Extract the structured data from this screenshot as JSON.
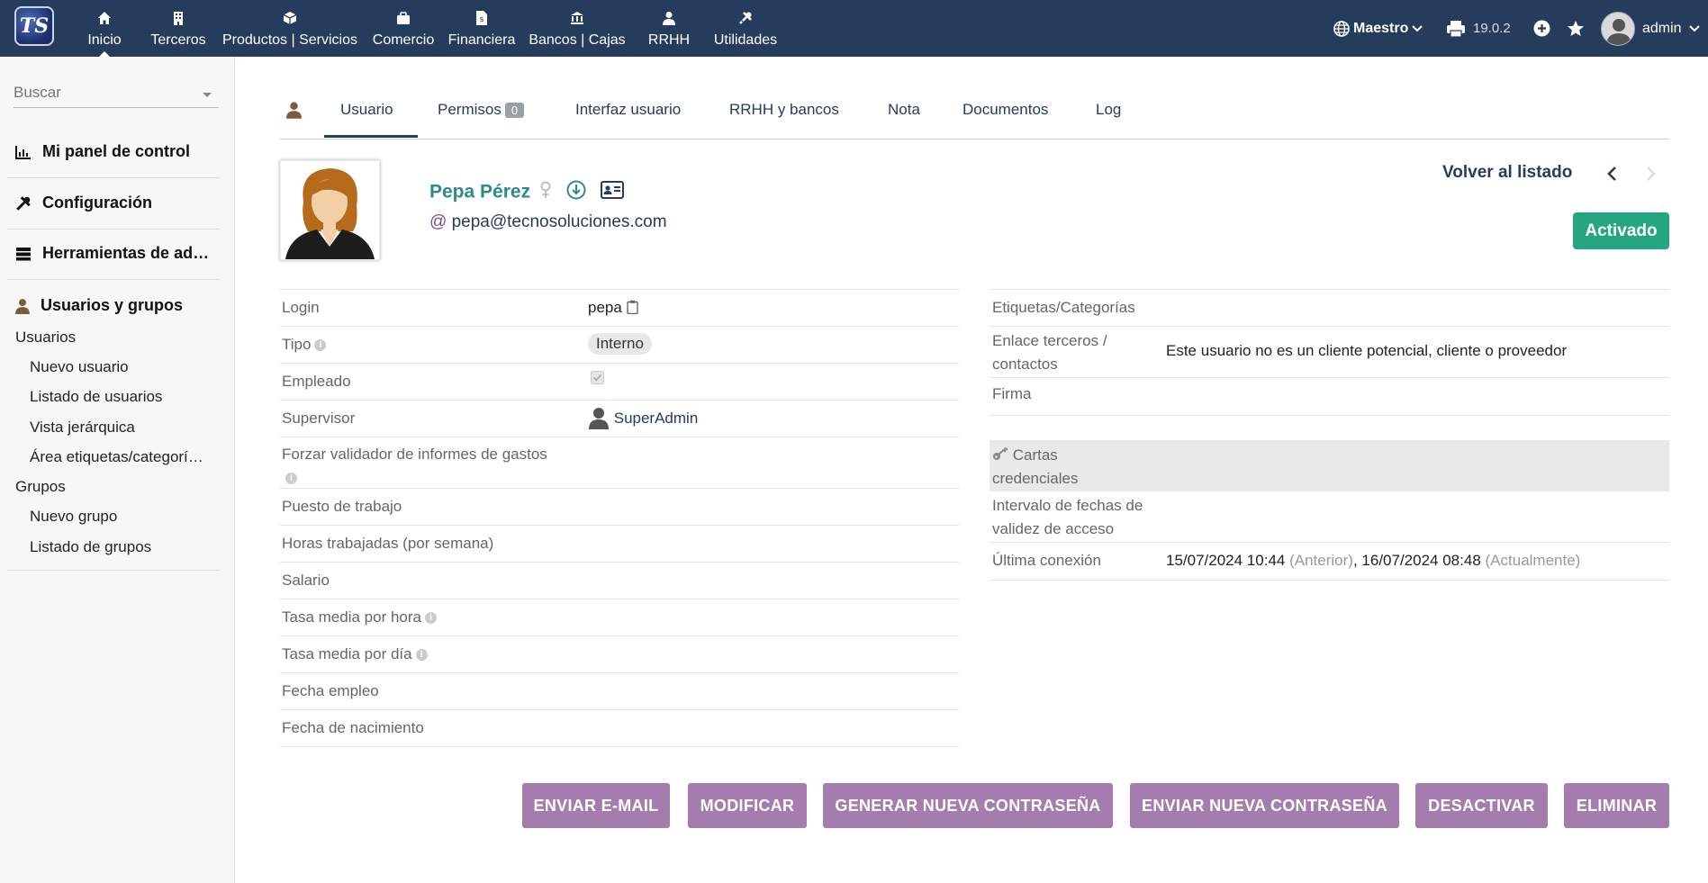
{
  "topbar": {
    "logo_text": "TS",
    "menu": [
      {
        "label": "Inicio",
        "icon": "home-icon"
      },
      {
        "label": "Terceros",
        "icon": "building-icon"
      },
      {
        "label": "Productos | Servicios",
        "icon": "cube-icon"
      },
      {
        "label": "Comercio",
        "icon": "briefcase-icon"
      },
      {
        "label": "Financiera",
        "icon": "invoice-icon"
      },
      {
        "label": "Bancos | Cajas",
        "icon": "bank-icon"
      },
      {
        "label": "RRHH",
        "icon": "user-icon"
      },
      {
        "label": "Utilidades",
        "icon": "tools-icon"
      }
    ],
    "entity": "Maestro",
    "version": "19.0.2",
    "user": "admin"
  },
  "sidebar": {
    "search_placeholder": "Buscar",
    "sections": [
      {
        "label": "Mi panel de control",
        "icon": "chart-icon"
      },
      {
        "label": "Configuración",
        "icon": "tools-icon"
      },
      {
        "label": "Herramientas de ad…",
        "icon": "server-icon"
      },
      {
        "label": "Usuarios y grupos",
        "icon": "user-icon"
      }
    ],
    "users_heading": "Usuarios",
    "users_links": [
      "Nuevo usuario",
      "Listado de usuarios",
      "Vista jerárquica",
      "Área etiquetas/categorí…"
    ],
    "groups_heading": "Grupos",
    "groups_links": [
      "Nuevo grupo",
      "Listado de grupos"
    ]
  },
  "tabs": {
    "items": [
      "Usuario",
      "Permisos",
      "Interfaz usuario",
      "RRHH y bancos",
      "Nota",
      "Documentos",
      "Log"
    ],
    "permisos_count": "0"
  },
  "header": {
    "name": "Pepa Pérez",
    "email_prefix": "@",
    "email": "pepa@tecnosoluciones.com",
    "back_label": "Volver al listado",
    "status": "Activado"
  },
  "left_fields": [
    {
      "label": "Login",
      "value": "pepa"
    },
    {
      "label": "Tipo",
      "value": "Interno"
    },
    {
      "label": "Empleado",
      "value": ""
    },
    {
      "label": "Supervisor",
      "value": "SuperAdmin"
    },
    {
      "label": "Forzar validador de informes de gastos",
      "value": ""
    },
    {
      "label": "Puesto de trabajo",
      "value": ""
    },
    {
      "label": "Horas trabajadas (por semana)",
      "value": ""
    },
    {
      "label": "Salario",
      "value": ""
    },
    {
      "label": "Tasa media por hora",
      "value": ""
    },
    {
      "label": "Tasa media por día",
      "value": ""
    },
    {
      "label": "Fecha empleo",
      "value": ""
    },
    {
      "label": "Fecha de nacimiento",
      "value": ""
    }
  ],
  "right_fields": {
    "tags_label": "Etiquetas/Categorías",
    "link_label_1": "Enlace terceros /",
    "link_label_2": "contactos",
    "link_value": "Este usuario no es un cliente potencial, cliente o proveedor",
    "signature_label": "Firma",
    "cards_label_1": "Cartas",
    "cards_label_2": "credenciales",
    "validity_label_1": "Intervalo de fechas de",
    "validity_label_2": "validez de acceso",
    "last_login_label": "Última conexión",
    "last_login_prev": "15/07/2024 10:44",
    "last_login_prev_tag": "(Anterior)",
    "last_login_sep": ",",
    "last_login_curr": "16/07/2024 08:48",
    "last_login_curr_tag": "(Actualmente)"
  },
  "actions": [
    "ENVIAR E-MAIL",
    "MODIFICAR",
    "GENERAR NUEVA CONTRASEÑA",
    "ENVIAR NUEVA CONTRASEÑA",
    "DESACTIVAR",
    "ELIMINAR"
  ],
  "colors": {
    "topbar": "#263c5c",
    "accent": "#a57cae",
    "status": "#25a580",
    "name": "#2e8b8b"
  }
}
